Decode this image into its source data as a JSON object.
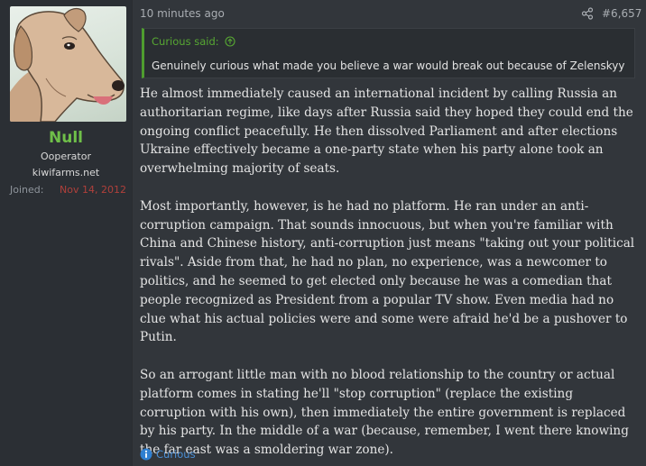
{
  "user": {
    "name": "Null",
    "title": "Ooperator",
    "site": "kiwifarms.net",
    "joined_label": "Joined:",
    "joined_date": "Nov 14, 2012",
    "avatar_icon": "dog-avatar-icon"
  },
  "post": {
    "time": "10 minutes ago",
    "number": "#6,657",
    "share_icon": "share-icon"
  },
  "quote": {
    "attribution": "Curious said:",
    "text": "Genuinely curious what made you believe a war would break out because of Zelenskyy"
  },
  "body": {
    "paragraphs": [
      "He almost immediately caused an international incident by calling Russia an authoritarian regime, like days after Russia said they hoped they could end the ongoing conflict peacefully. He then dissolved Parliament and after elections Ukraine effectively became a one-party state when his party alone took an overwhelming majority of seats.",
      "Most importantly, however, is he had no platform. He ran under an anti-corruption campaign. That sounds innocuous, but when you're familiar with China and Chinese history, anti-corruption just means \"taking out your political rivals\". Aside from that, he had no plan, no experience, was a newcomer to politics, and he seemed to get elected only because he was a comedian that people recognized as President from a popular TV show. Even media had no clue what his actual policies were and some were afraid he'd be a pushover to Putin.",
      "So an arrogant little man with no blood relationship to the country or actual platform comes in stating he'll \"stop corruption\" (replace the existing corruption with his own), then immediately the entire government is replaced by his party. In the middle of a war (because, remember, I went there knowing the far east was a smoldering war zone)."
    ]
  },
  "reaction": {
    "label": "Curious",
    "icon": "info-icon"
  },
  "colors": {
    "username": "#6fbf49",
    "joined_date": "#b0403b",
    "quote_accent": "#4f9d2f",
    "reaction": "#4a8fd6"
  }
}
